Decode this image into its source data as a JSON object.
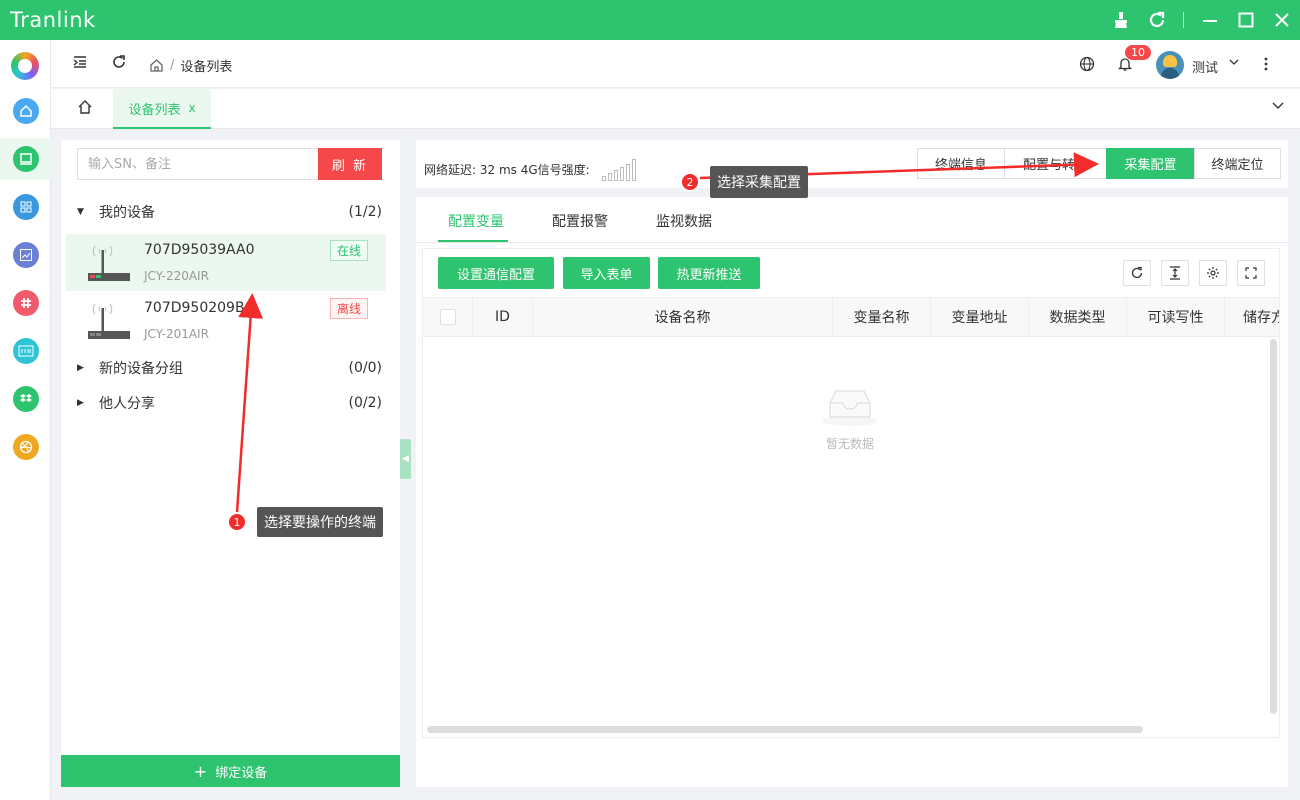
{
  "app": {
    "title": "Tranlink"
  },
  "header": {
    "breadcrumb": "设备列表",
    "notification_count": "10",
    "username": "测试"
  },
  "tabs": {
    "active_label": "设备列表",
    "close": "x"
  },
  "device_panel": {
    "search_placeholder": "输入SN、备注",
    "refresh_label": "刷 新",
    "groups": [
      {
        "label": "我的设备",
        "count": "(1/2)",
        "expanded": true
      },
      {
        "label": "新的设备分组",
        "count": "(0/0)",
        "expanded": false
      },
      {
        "label": "他人分享",
        "count": "(0/2)",
        "expanded": false
      }
    ],
    "devices": [
      {
        "sn": "707D95039AA0",
        "model": "JCY-220AIR",
        "status": "在线"
      },
      {
        "sn": "707D950209B4",
        "model": "JCY-201AIR",
        "status": "离线"
      }
    ],
    "bind_label": "绑定设备"
  },
  "infobar": {
    "network_text": "网络延迟: 32 ms 4G信号强度:",
    "tabs": [
      "终端信息",
      "配置与转换",
      "采集配置",
      "终端定位"
    ],
    "active_tab": "采集配置"
  },
  "main": {
    "subtabs": [
      "配置变量",
      "配置报警",
      "监视数据"
    ],
    "active_subtab": "配置变量",
    "toolbar": [
      "设置通信配置",
      "导入表单",
      "热更新推送"
    ],
    "columns": [
      "ID",
      "设备名称",
      "变量名称",
      "变量地址",
      "数据类型",
      "可读写性",
      "储存方"
    ],
    "empty_text": "暂无数据"
  },
  "annotations": [
    {
      "num": "1",
      "text": "选择要操作的终端"
    },
    {
      "num": "2",
      "text": "选择采集配置"
    }
  ],
  "colors": {
    "accent": "#2ec46f",
    "danger": "#f5484a",
    "annotation": "#f22b2b"
  }
}
